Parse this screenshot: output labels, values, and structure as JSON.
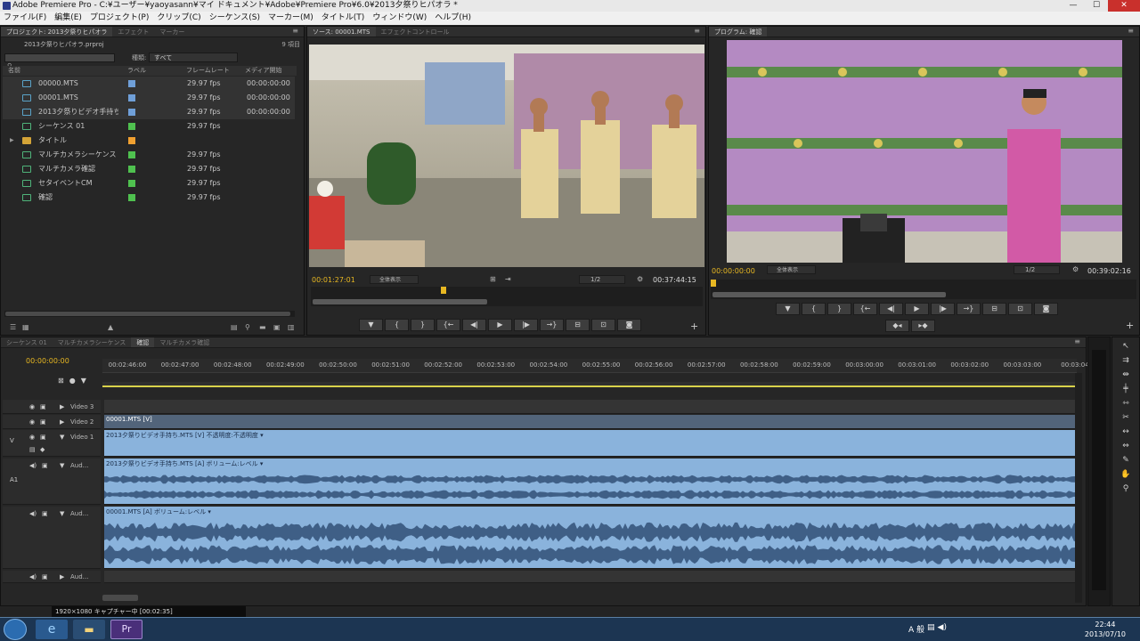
{
  "window": {
    "title": "Adobe Premiere Pro - C:¥ユーザー¥yaoyasann¥マイ ドキュメント¥Adobe¥Premiere Pro¥6.0¥2013夕祭りヒパオラ *"
  },
  "menu": [
    "ファイル(F)",
    "編集(E)",
    "プロジェクト(P)",
    "クリップ(C)",
    "シーケンス(S)",
    "マーカー(M)",
    "タイトル(T)",
    "ウィンドウ(W)",
    "ヘルプ(H)"
  ],
  "project": {
    "tabs": [
      "プロジェクト: 2013夕祭りヒパオラ",
      "エフェクト",
      "マーカー"
    ],
    "file": "2013夕祭りヒパオラ.prproj",
    "count": "9 項目",
    "in_label": "種類:",
    "in_value": "すべて",
    "columns": [
      "名前",
      "ラベル",
      "フレームレート",
      "メディア開始"
    ],
    "items": [
      {
        "name": "00000.MTS",
        "kind": "clip",
        "label_color": "#6f9fd8",
        "fps": "29.97 fps",
        "start": "00:00:00:00"
      },
      {
        "name": "00001.MTS",
        "kind": "clip",
        "label_color": "#6f9fd8",
        "fps": "29.97 fps",
        "start": "00:00:00:00"
      },
      {
        "name": "2013夕祭りビデオ手持ち",
        "kind": "clip",
        "label_color": "#6f9fd8",
        "fps": "29.97 fps",
        "start": "00:00:00:00"
      },
      {
        "name": "シーケンス 01",
        "kind": "seq",
        "label_color": "#4fc14f",
        "fps": "29.97 fps",
        "start": ""
      },
      {
        "name": "タイトル",
        "kind": "folder",
        "label_color": "#f0a030",
        "fps": "",
        "start": ""
      },
      {
        "name": "マルチカメラシーケンス",
        "kind": "seq",
        "label_color": "#4fc14f",
        "fps": "29.97 fps",
        "start": ""
      },
      {
        "name": "マルチカメラ確認",
        "kind": "seq",
        "label_color": "#4fc14f",
        "fps": "29.97 fps",
        "start": ""
      },
      {
        "name": "セタイベントCM",
        "kind": "seq",
        "label_color": "#4fc14f",
        "fps": "29.97 fps",
        "start": ""
      },
      {
        "name": "確認",
        "kind": "seq",
        "label_color": "#4fc14f",
        "fps": "29.97 fps",
        "start": ""
      }
    ]
  },
  "source": {
    "tabs": [
      "ソース: 00001.MTS",
      "エフェクトコントロール"
    ],
    "timecode": "00:01:27:01",
    "zoom": "全体表示",
    "resolution": "1/2",
    "duration": "00:37:44:15"
  },
  "program": {
    "tabs": [
      "プログラム: 確認"
    ],
    "timecode": "00:00:00:00",
    "zoom": "全体表示",
    "resolution": "1/2",
    "duration": "00:39:02:16"
  },
  "timeline": {
    "tabs": [
      "シーケンス 01",
      "マルチカメラシーケンス",
      "確認",
      "マルチカメラ確認"
    ],
    "timecode": "00:00:00:00",
    "ruler": [
      "00:02:46:00",
      "00:02:47:00",
      "00:02:48:00",
      "00:02:49:00",
      "00:02:50:00",
      "00:02:51:00",
      "00:02:52:00",
      "00:02:53:00",
      "00:02:54:00",
      "00:02:55:00",
      "00:02:56:00",
      "00:02:57:00",
      "00:02:58:00",
      "00:02:59:00",
      "00:03:00:00",
      "00:03:01:00",
      "00:03:02:00",
      "00:03:03:00",
      "00:03:04"
    ],
    "tracks": {
      "video3": "Video 3",
      "video2": "Video 2",
      "video1": "Video 1",
      "audio": "Aud...",
      "v_label": "V",
      "a1_label": "A1"
    },
    "clips": {
      "v2": "00001.MTS [V]",
      "v1": "2013夕祭りビデオ手持ち.MTS [V]  不透明度:不透明度 ▾",
      "a1": "2013夕祭りビデオ手持ち.MTS [A]  ボリューム:レベル ▾",
      "a2": "00001.MTS [A]  ボリューム:レベル ▾"
    }
  },
  "capture": {
    "text": "1920×1080 キャプチャー中 [00:02:35]"
  },
  "taskbar": {
    "time": "22:44",
    "date": "2013/07/10",
    "ime": "A 般"
  }
}
